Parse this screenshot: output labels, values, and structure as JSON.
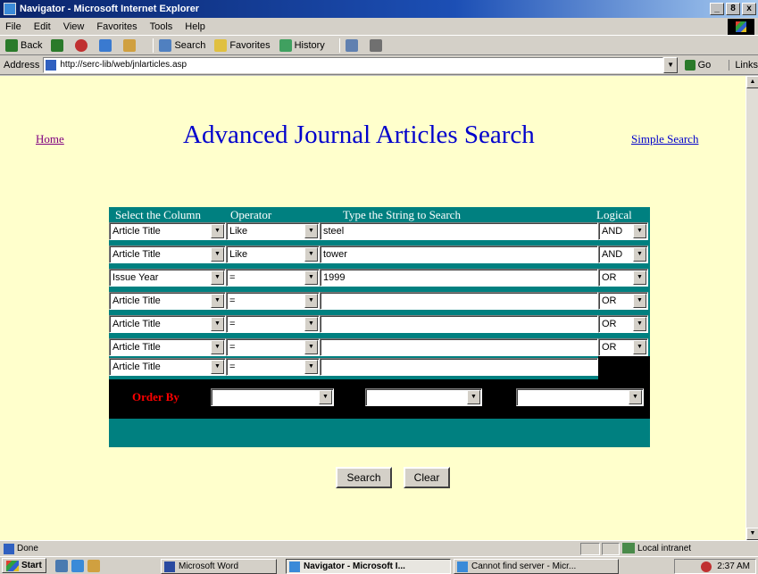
{
  "window": {
    "title": "Navigator - Microsoft Internet Explorer",
    "buttons": [
      "_",
      "8",
      "x"
    ]
  },
  "menu": [
    "File",
    "Edit",
    "View",
    "Favorites",
    "Tools",
    "Help"
  ],
  "toolbar": {
    "back": "Back",
    "search": "Search",
    "favorites": "Favorites",
    "history": "History"
  },
  "address": {
    "label": "Address",
    "url": "http://serc-lib/web/jnlarticles.asp",
    "go": "Go",
    "links": "Links"
  },
  "page": {
    "home": "Home",
    "title": "Advanced Journal Articles Search",
    "simple_search": "Simple Search"
  },
  "table": {
    "headers": {
      "column": "Select the Column",
      "operator": "Operator",
      "string": "Type the String to Search",
      "logical": "Logical"
    },
    "rows": [
      {
        "column": "Article Title",
        "operator": "Like",
        "value": "steel",
        "logical": "AND"
      },
      {
        "column": "Article Title",
        "operator": "Like",
        "value": "tower",
        "logical": "AND"
      },
      {
        "column": "Issue Year",
        "operator": "=",
        "value": "1999",
        "logical": "OR"
      },
      {
        "column": "Article Title",
        "operator": "=",
        "value": "",
        "logical": "OR"
      },
      {
        "column": "Article Title",
        "operator": "=",
        "value": "",
        "logical": "OR"
      },
      {
        "column": "Article Title",
        "operator": "=",
        "value": "",
        "logical": "OR"
      },
      {
        "column": "Article Title",
        "operator": "=",
        "value": "",
        "logical": ""
      }
    ],
    "order_by": "Order By",
    "order_selects": [
      "",
      "",
      ""
    ]
  },
  "buttons": {
    "search": "Search",
    "clear": "Clear"
  },
  "status": {
    "text": "Done",
    "zone": "Local intranet"
  },
  "taskbar": {
    "start": "Start",
    "tasks": [
      "Microsoft Word",
      "Navigator - Microsoft I...",
      "Cannot find server - Micr..."
    ],
    "clock": "2:37 AM"
  },
  "colors": {
    "page_bg": "#ffffcc",
    "table_teal": "#008080",
    "title_blue": "#0000cc",
    "order_red": "#ff0000"
  }
}
